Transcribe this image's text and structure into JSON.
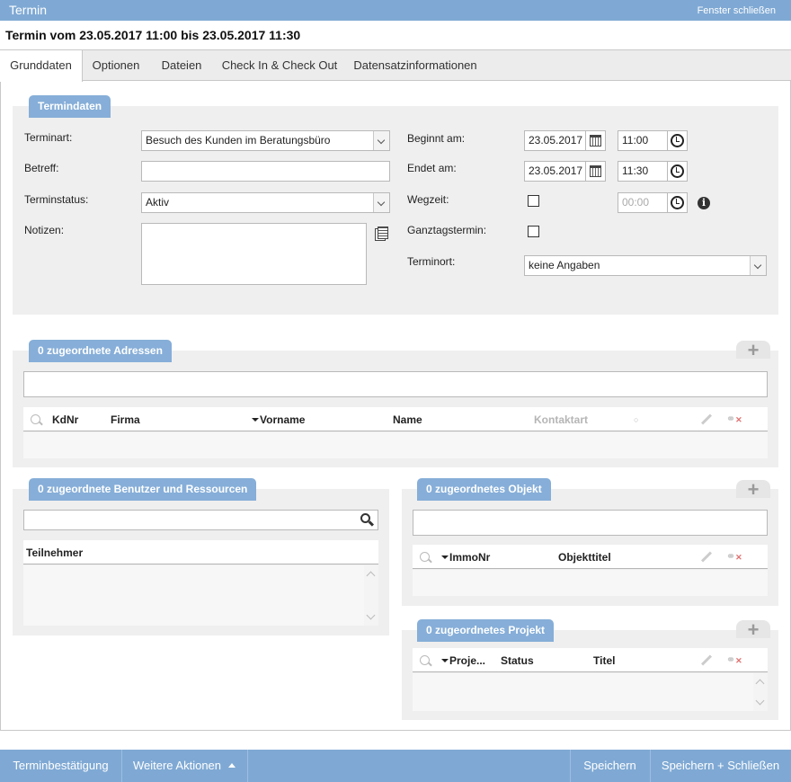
{
  "window": {
    "title": "Termin",
    "close_label": "Fenster schließen"
  },
  "heading": "Termin vom 23.05.2017 11:00 bis 23.05.2017 11:30",
  "tabs": [
    {
      "label": "Grunddaten",
      "active": true
    },
    {
      "label": "Optionen",
      "active": false
    },
    {
      "label": "Dateien",
      "active": false
    },
    {
      "label": "Check In & Check Out",
      "active": false
    },
    {
      "label": "Datensatzinformationen",
      "active": false
    }
  ],
  "termindaten": {
    "title": "Termindaten",
    "terminart": {
      "label": "Terminart:",
      "value": "Besuch des Kunden im Beratungsbüro"
    },
    "betreff": {
      "label": "Betreff:",
      "value": ""
    },
    "terminstatus": {
      "label": "Terminstatus:",
      "value": "Aktiv"
    },
    "notizen": {
      "label": "Notizen:",
      "value": ""
    },
    "beginnt": {
      "label": "Beginnt am:",
      "date": "23.05.2017",
      "time": "11:00"
    },
    "endet": {
      "label": "Endet am:",
      "date": "23.05.2017",
      "time": "11:30"
    },
    "wegzeit": {
      "label": "Wegzeit:",
      "checked": false,
      "time": "00:00"
    },
    "ganztags": {
      "label": "Ganztagstermin:",
      "checked": false
    },
    "terminort": {
      "label": "Terminort:",
      "value": "keine Angaben"
    }
  },
  "adressen": {
    "title": "0 zugeordnete Adressen",
    "search_value": "",
    "columns": [
      "KdNr",
      "Firma",
      "Vorname",
      "Name",
      "Kontaktart"
    ]
  },
  "benutzer": {
    "title": "0 zugeordnete Benutzer und Ressourcen",
    "search_value": "",
    "column": "Teilnehmer"
  },
  "objekt": {
    "title": "0 zugeordnetes Objekt",
    "search_value": "",
    "columns": [
      "ImmoNr",
      "Objekttitel"
    ]
  },
  "projekt": {
    "title": "0 zugeordnetes Projekt",
    "columns": [
      "Proje...",
      "Status",
      "Titel"
    ]
  },
  "footer": {
    "confirm": "Terminbestätigung",
    "more": "Weitere Aktionen",
    "save": "Speichern",
    "save_close": "Speichern + Schließen"
  }
}
